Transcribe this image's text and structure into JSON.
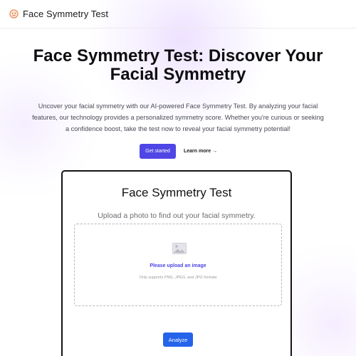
{
  "header": {
    "brand": "Face Symmetry Test",
    "logo_icon": "face-logo-icon"
  },
  "hero": {
    "title": "Face Symmetry Test: Discover Your Facial Symmetry",
    "description": "Uncover your facial symmetry with our AI-powered Face Symmetry Test. By analyzing your facial features, our technology provides a personalized symmetry score. Whether you're curious or seeking a confidence boost, take the test now to reveal your facial symmetry potential!",
    "primary_cta": "Get started",
    "secondary_cta": "Learn more →"
  },
  "tool_card": {
    "title": "Face Symmetry Test",
    "subtitle": "Upload a photo to find out your facial symmetry.",
    "upload": {
      "icon": "image-icon",
      "label": "Please upload an image",
      "hint": "Only supports PNG, JPEG, and JPG formats"
    },
    "analyze_button": "Analyze"
  },
  "colors": {
    "accent": "#4f46e5",
    "analyze": "#2563eb",
    "logo": "#e87a3e"
  }
}
